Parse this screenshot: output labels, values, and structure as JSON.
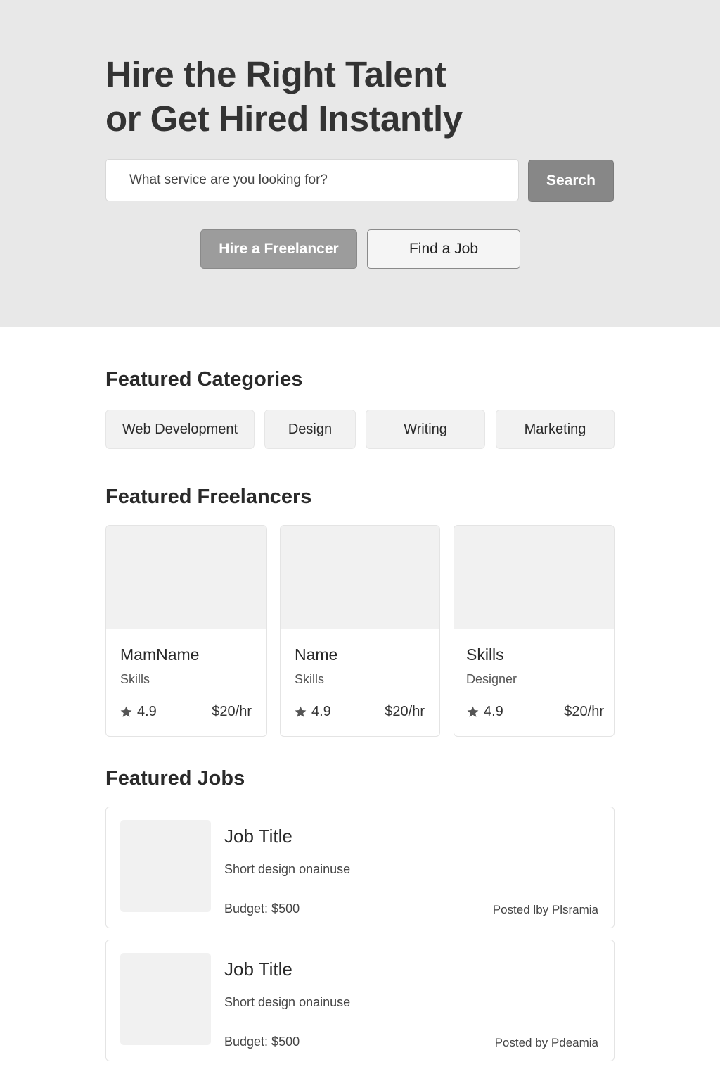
{
  "hero": {
    "title_line1": "Hire the Right Talent",
    "title_line2": "or Get Hired Instantly",
    "search_placeholder": "What service are you looking for?",
    "search_button": "Search",
    "hire_button": "Hire a Freelancer",
    "find_job_button": "Find a Job"
  },
  "categories": {
    "heading": "Featured Categories",
    "items": [
      "Web Development",
      "Design",
      "Writing",
      "Marketing"
    ]
  },
  "freelancers": {
    "heading": "Featured Freelancers",
    "items": [
      {
        "name": "MamName",
        "subtitle": "Skills",
        "rating": "4.9",
        "rate": "$20/hr"
      },
      {
        "name": "Name",
        "subtitle": "Skills",
        "rating": "4.9",
        "rate": "$20/hr"
      },
      {
        "name": "Skills",
        "subtitle": "Designer",
        "rating": "4.9",
        "rate": "$20/hr"
      }
    ]
  },
  "jobs": {
    "heading": "Featured Jobs",
    "items": [
      {
        "title": "Job Title",
        "description": "Short design onainuse",
        "budget": "Budget: $500",
        "posted": "Posted lby Plsramia"
      },
      {
        "title": "Job Title",
        "description": "Short design onainuse",
        "budget": "Budget: $500",
        "posted": "Posted by Pdeamia"
      }
    ]
  },
  "colors": {
    "hero_bg": "#e8e8e8",
    "search_button_bg": "#878787",
    "hire_button_bg": "#9c9c9c",
    "chip_bg": "#f2f2f2",
    "placeholder_bg": "#f1f1f1",
    "star": "#555555"
  },
  "icons": {
    "rating": "star-icon"
  }
}
